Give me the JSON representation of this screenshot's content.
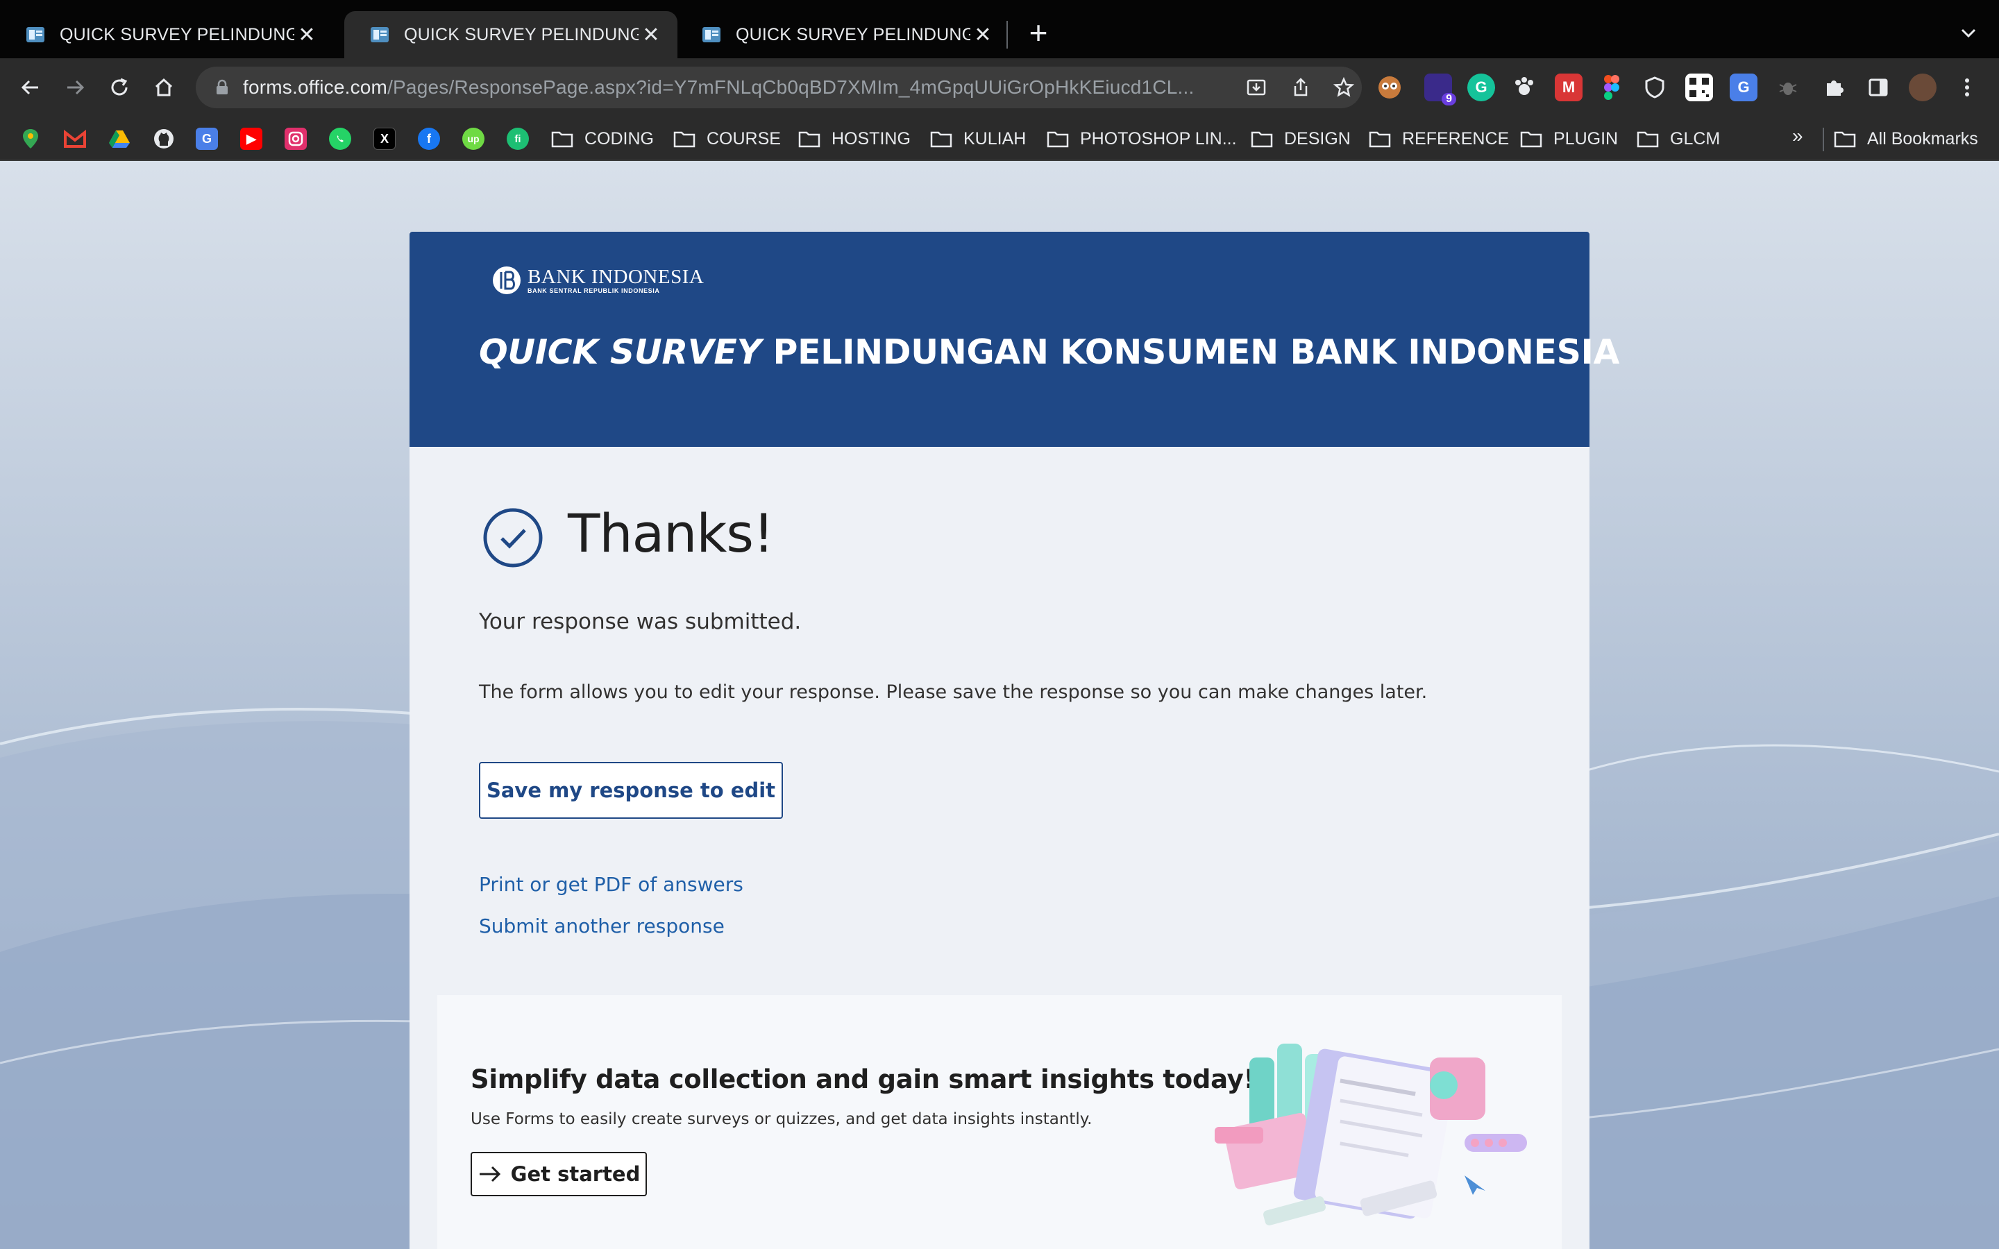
{
  "browser": {
    "tabs": [
      {
        "title": "QUICK SURVEY PELINDUNGAN KONSUMEN BANK INDONESIA",
        "active": false
      },
      {
        "title": "QUICK SURVEY PELINDUNGAN KONSUMEN BANK INDONESIA",
        "active": true
      },
      {
        "title": "QUICK SURVEY PELINDUNGAN KONSUMEN BANK INDONESIA",
        "active": false
      }
    ],
    "url_host": "forms.office.com",
    "url_path": "/Pages/ResponsePage.aspx?id=Y7mFNLqCb0qBD7XMIm_4mGpqUUiGrOpHkKEiucd1CL...",
    "extension_badge": "9",
    "bookmark_folders": [
      "CODING",
      "COURSE",
      "HOSTING",
      "KULIAH",
      "PHOTOSHOP LIN...",
      "DESIGN",
      "REFERENCE",
      "PLUGIN",
      "GLCM"
    ],
    "bookmark_more": "»",
    "all_bookmarks": "All Bookmarks"
  },
  "form": {
    "logo_name": "BANK INDONESIA",
    "logo_sub": "BANK SENTRAL REPUBLIK INDONESIA",
    "title_italic": "QUICK SURVEY",
    "title_rest": " PELINDUNGAN KONSUMEN BANK INDONESIA",
    "thanks": "Thanks!",
    "submitted": "Your response was submitted.",
    "edit_note": "The form allows you to edit your response. Please save the response so you can make changes later.",
    "save_button": "Save my response to edit",
    "print_link": "Print or get PDF of answers",
    "another_link": "Submit another response"
  },
  "promo": {
    "title": "Simplify data collection and gain smart insights today!",
    "description": "Use Forms to easily create surveys or quizzes, and get data insights instantly.",
    "button": "Get started"
  },
  "colors": {
    "banner": "#1f4886",
    "accent": "#1f4886",
    "link": "#1f5fa8"
  }
}
